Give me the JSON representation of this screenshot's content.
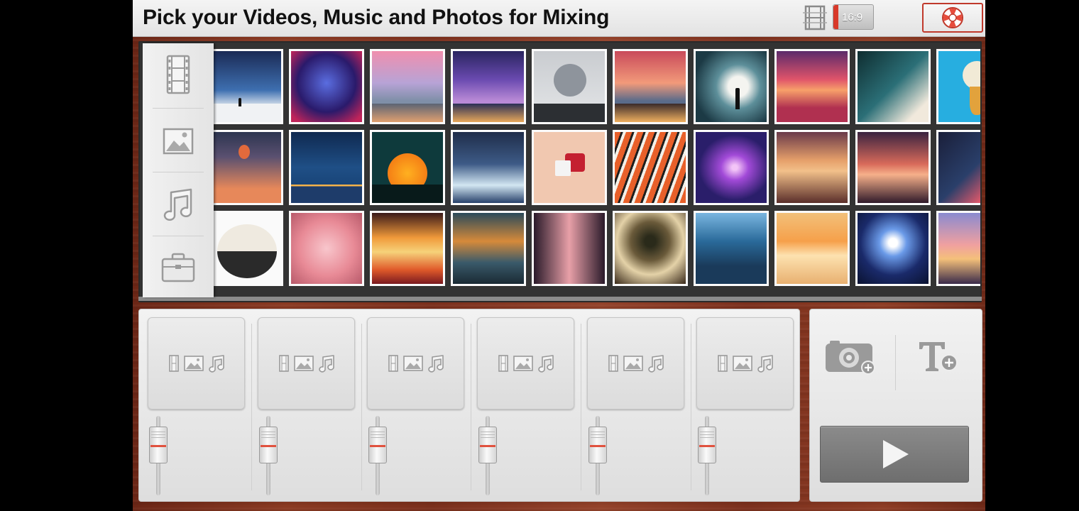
{
  "header": {
    "title": "Pick your Videos, Music and Photos for Mixing",
    "ratio_label": "16:9"
  },
  "sidebar": {
    "items": [
      "film-icon",
      "photo-icon",
      "music-note-icon",
      "briefcase-icon"
    ]
  },
  "mixer": {
    "channel_count": 6,
    "fader_level": 0.75
  },
  "colors": {
    "accent_red": "#d8392a",
    "wood": "#8a3a22",
    "panel": "#ececec",
    "play_button": "#7a7a7a"
  }
}
